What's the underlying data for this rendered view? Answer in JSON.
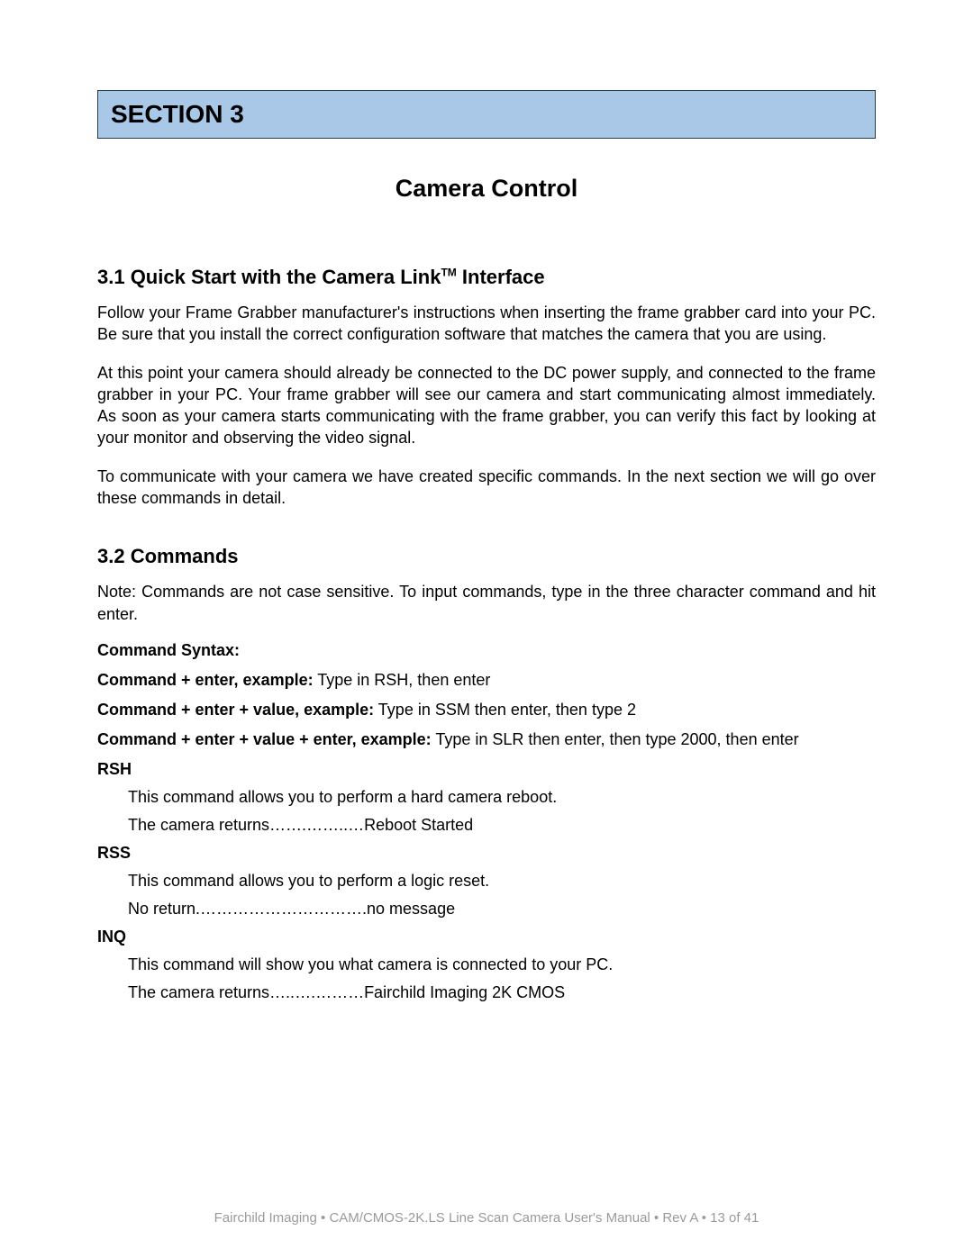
{
  "section_banner": "SECTION 3",
  "chapter_title": "Camera Control",
  "sub31_prefix": "3.1  Quick Start with the Camera Link",
  "sub31_tm": "TM",
  "sub31_suffix": " Interface",
  "p31_1": "Follow your Frame Grabber manufacturer's instructions when inserting the frame grabber card into your PC.  Be sure that you install the correct configuration software that matches the camera that you are using.",
  "p31_2": "At this point your camera should already be connected to the DC power supply, and connected to the frame grabber in your PC.  Your frame grabber will see our camera and start communicating almost immediately.  As soon as your camera starts communicating with the frame grabber, you can verify this fact by looking at your monitor and observing the video signal.",
  "p31_3": "To communicate with your camera we have created specific commands.  In the next section we will go over these commands in detail.",
  "sub32": "3.2  Commands",
  "p32_note": "Note:   Commands are not case sensitive.  To input commands, type in the three character command and hit enter.",
  "cmd_syntax_label": "Command Syntax:",
  "cmd_ex1_bold": "Command + enter, example:",
  "cmd_ex1_rest": "  Type in RSH, then enter",
  "cmd_ex2_bold": "Command + enter + value, example:",
  "cmd_ex2_rest": "  Type in SSM then enter, then type 2",
  "cmd_ex3_bold": "Command + enter + value + enter, example:",
  "cmd_ex3_rest": "  Type in SLR then enter, then type 2000, then enter",
  "rsh_name": "RSH",
  "rsh_d1": "This command allows you to perform a hard camera reboot.",
  "rsh_d2": "The camera returns…….……..…Reboot Started",
  "rss_name": "RSS",
  "rss_d1": "This command allows you to perform a logic reset.",
  "rss_d2": "No return.………………………….no message",
  "inq_name": "INQ",
  "inq_d1": "This command will show you what camera is connected to your PC.",
  "inq_d2": "The camera returns…..….………Fairchild Imaging 2K CMOS",
  "footer": "Fairchild Imaging • CAM/CMOS-2K.LS Line Scan Camera User's Manual • Rev A • 13 of 41"
}
